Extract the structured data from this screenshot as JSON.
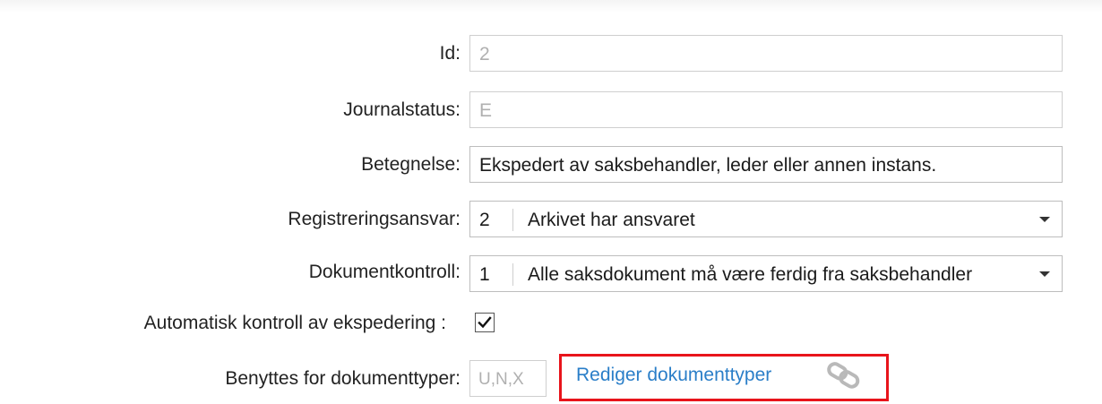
{
  "form": {
    "id": {
      "label": "Id:",
      "value": "2"
    },
    "journalstatus": {
      "label": "Journalstatus:",
      "value": "E"
    },
    "betegnelse": {
      "label": "Betegnelse:",
      "value": "Ekspedert av saksbehandler, leder eller annen instans."
    },
    "registreringsansvar": {
      "label": "Registreringsansvar:",
      "code": "2",
      "text": "Arkivet har ansvaret"
    },
    "dokumentkontroll": {
      "label": "Dokumentkontroll:",
      "code": "1",
      "text": "Alle saksdokument må være ferdig fra saksbehandler"
    },
    "automatisk_kontroll": {
      "label": "Automatisk kontroll av ekspedering :",
      "checked": true
    },
    "benyttes": {
      "label": "Benyttes for dokumenttyper:",
      "value": "U,N,X"
    },
    "rediger_link": {
      "label": "Rediger dokumenttyper",
      "icon": "link-chain-icon"
    }
  },
  "colors": {
    "link": "#2a7ec8",
    "highlight_border": "#e8141b",
    "readonly_text": "#b0b0b0"
  }
}
